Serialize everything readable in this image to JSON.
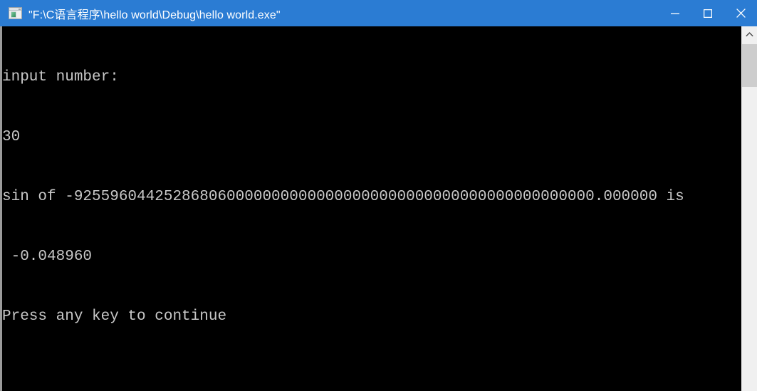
{
  "window": {
    "title": "\"F:\\C语言程序\\hello world\\Debug\\hello world.exe\"",
    "icon_name": "console-app-icon",
    "titlebar_color": "#2b7cd3",
    "title_text_color": "#ffffff",
    "background_color": "#000000",
    "text_color": "#c8c8c8"
  },
  "controls": {
    "minimize_label": "—",
    "maximize_label": "□",
    "close_label": "✕"
  },
  "console": {
    "lines": [
      "input number:",
      "30",
      "sin of -9255960442528680600000000000000000000000000000000000000000.000000 is",
      " -0.048960",
      "Press any key to continue"
    ]
  },
  "scrollbar": {
    "up_arrow": "⌃",
    "thumb_color": "#cdcdcd",
    "track_color": "#f0f0f0"
  }
}
